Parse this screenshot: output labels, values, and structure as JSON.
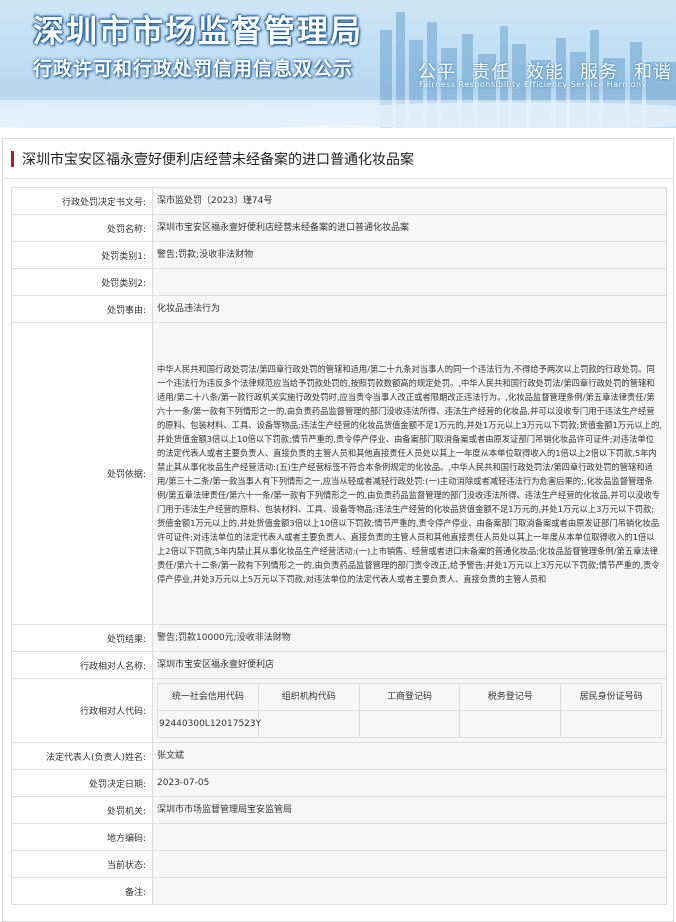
{
  "header": {
    "title": "深圳市市场监督管理局",
    "subtitle": "行政许可和行政处罚信用信息双公示",
    "slogan": [
      "公平",
      "责任",
      "效能",
      "服务",
      "和谐"
    ],
    "slogan_en": "Fairness  Responsibility  Efficiency  Service  Harmony"
  },
  "page": {
    "title": "深圳市宝安区福永壹好便利店经营未经备案的进口普通化妆品案"
  },
  "fields": {
    "decision_no": {
      "label": "行政处罚决定书文号:",
      "value": "深市监处罚〔2023〕瑾74号"
    },
    "case_name": {
      "label": "处罚名称:",
      "value": "深圳市宝安区福永壹好便利店经营未经备案的进口普通化妆品案"
    },
    "category1": {
      "label": "处罚类别1:",
      "value": "警告;罚款;没收非法财物"
    },
    "category2": {
      "label": "处罚类别2:",
      "value": ""
    },
    "reason": {
      "label": "处罚事由:",
      "value": "化妆品违法行为"
    },
    "basis": {
      "label": "处罚依据:",
      "value": "中华人民共和国行政处罚法/第四章行政处罚的管辖和适用/第二十九条对当事人的同一个违法行为,不得给予两次以上罚款的行政处罚。同一个违法行为违反多个法律规范应当给予罚款处罚的,按照罚款数额高的规定处罚。,中华人民共和国行政处罚法/第四章行政处罚的管辖和适用/第二十八条/第一款行政机关实施行政处罚时,应当责令当事人改正或者限期改正违法行为。,化妆品监督管理条例/第五章法律责任/第六十一条/第一款有下列情形之一的,由负责药品监督管理的部门没收违法所得、违法生产经营的化妆品,并可以没收专门用于违法生产经营的原料、包装材料、工具、设备等物品;违法生产经营的化妆品货值金额不足1万元的,并处1万元以上3万元以下罚款;货值金额1万元以上的,并处货值金额3倍以上10倍以下罚款;情节严重的,责令停产停业、由备案部门取消备案或者由原发证部门吊销化妆品许可证件;对违法单位的法定代表人或者主要负责人、直接负责的主管人员和其他直接责任人员处以其上一年度从本单位取得收入的1倍以上2倍以下罚款,5年内禁止其从事化妆品生产经营活动:(五)生产经营标签不符合本条例规定的化妆品。,中华人民共和国行政处罚法/第四章行政处罚的管辖和适用/第三十二条/第一款当事人有下列情形之一,应当从轻或者减轻行政处罚:(一)主动消除或者减轻违法行为危害后果的;,化妆品监督管理条例/第五章法律责任/第六十一条/第一款有下列情形之一的,由负责药品监督管理的部门没收违法所得、违法生产经营的化妆品,并可以没收专门用于违法生产经营的原料、包装材料、工具、设备等物品;违法生产经营的化妆品货值金额不足1万元的,并处1万元以上3万元以下罚款;货值金额1万元以上的,并处货值金额3倍以上10倍以下罚款;情节严重的,责令停产停业、由备案部门取消备案或者由原发证部门吊销化妆品许可证件;对违法单位的法定代表人或者主要负责人、直接负责的主管人员和其他直接责任人员处以其上一年度从本单位取得收入的1倍以上2倍以下罚款,5年内禁止其从事化妆品生产经营活动:(一)上市销售、经营或者进口未备案的普通化妆品;化妆品监督管理条例/第五章法律责任/第六十二条/第一款有下列情形之一的,由负责药品监督管理的部门责令改正,给予警告;并处1万元以上3万元以下罚款;情节严重的,责令停产停业,并处3万元以上5万元以下罚款,对违法单位的法定代表人或者主要负责人、直接负责的主管人员和"
    },
    "result": {
      "label": "处罚结果:",
      "value": "警告;罚款10000元;没收非法财物"
    },
    "party_name": {
      "label": "行政相对人名称:",
      "value": "深圳市宝安区福永壹好便利店"
    },
    "party_code": {
      "label": "行政相对人代码:",
      "headers": [
        "统一社会信用代码",
        "组织机构代码",
        "工商登记码",
        "税务登记号",
        "居民身份证号码"
      ],
      "values": [
        "92440300L12017523Y",
        "",
        "",
        "",
        ""
      ]
    },
    "legal_rep": {
      "label": "法定代表人(负责人)姓名:",
      "value": "张文斌"
    },
    "decision_date": {
      "label": "处罚决定日期:",
      "value": "2023-07-05"
    },
    "authority": {
      "label": "处罚机关:",
      "value": "深圳市市场监督管理局宝安监管局"
    },
    "area_code": {
      "label": "地方编码:",
      "value": ""
    },
    "status": {
      "label": "当前状态:",
      "value": ""
    },
    "remark": {
      "label": "备注:",
      "value": ""
    }
  }
}
